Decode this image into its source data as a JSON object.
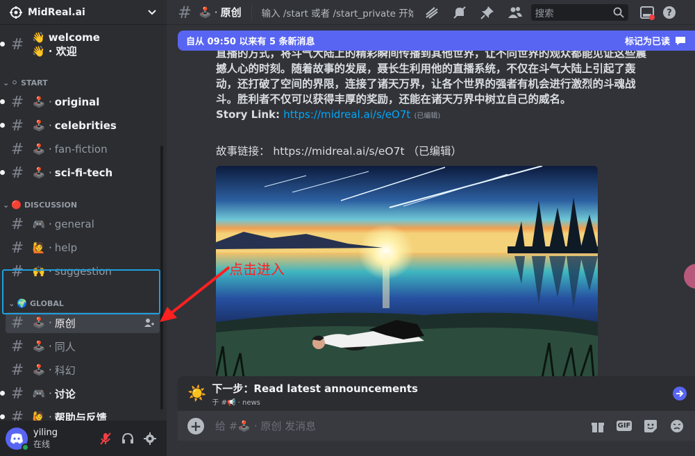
{
  "server": {
    "name": "MidReal.ai"
  },
  "channels": {
    "welcome": {
      "emoji": "👋",
      "name": "welcome",
      "emoji2": "👋",
      "sep": "·",
      "name2": "欢迎"
    },
    "start_category": {
      "emoji": "⚪",
      "label": "START"
    },
    "start_items": [
      {
        "emoji": "🕹️",
        "sep": "·",
        "name": "original"
      },
      {
        "emoji": "🕹️",
        "sep": "·",
        "name": "celebrities"
      },
      {
        "emoji": "🕹️",
        "sep": "·",
        "name": "fan-fiction"
      },
      {
        "emoji": "🕹️",
        "sep": "·",
        "name": "sci-fi-tech"
      }
    ],
    "discussion_category": {
      "emoji": "🔴",
      "label": "DISCUSSION"
    },
    "discussion_items": [
      {
        "emoji": "🎮",
        "sep": "·",
        "name": "general"
      },
      {
        "emoji": "🙋",
        "sep": "·",
        "name": "help"
      },
      {
        "emoji": "🙌",
        "sep": "·",
        "name": "suggestion"
      }
    ],
    "global_category": {
      "emoji": "🌍",
      "label": "GLOBAL"
    },
    "global_items": [
      {
        "emoji": "🕹️",
        "sep": "·",
        "name": "原创"
      },
      {
        "emoji": "🕹️",
        "sep": "·",
        "name": "同人"
      },
      {
        "emoji": "🕹️",
        "sep": "·",
        "name": "科幻"
      },
      {
        "emoji": "🎮",
        "sep": "·",
        "name": "讨论"
      },
      {
        "emoji": "🙋",
        "sep": "·",
        "name": "帮助与反馈"
      }
    ]
  },
  "user": {
    "name": "yiling",
    "status": "在线"
  },
  "header": {
    "hash": "#",
    "emoji": "🕹️",
    "sep": "·",
    "title": "原创",
    "topic": "输入 /start 或者 /start_private 开始",
    "search_placeholder": "搜索"
  },
  "banner": {
    "text": "自从 09:50 以来有 5 条新消息",
    "mark_read": "标记为已读"
  },
  "message": {
    "line0": "直播的方式，将斗气大陆上的精彩瞬间传播到其他世界，让不同世界的观众都能见证这些震",
    "line1": "撼人心的时刻。随着故事的发展，聂长生利用他的直播系统，不仅在斗气大陆上引起了轰",
    "line2": "动，还打破了空间的界限，连接了诸天万界，让各个世界的强者有机会进行激烈的斗魂战",
    "line3": "斗。胜利者不仅可以获得丰厚的奖励，还能在诸天万界中树立自己的威名。",
    "story_link_label": "Story Link:",
    "story_link_url": "https://midreal.ai/s/eO7t",
    "edited": "(已编辑)",
    "story_link2": "故事链接： https://midreal.ai/s/eO7t （已编辑）"
  },
  "annotation": {
    "text": "点击进入"
  },
  "next_step": {
    "prefix": "下一步：",
    "title": "Read latest announcements",
    "sub_prefix": "于 #",
    "sub_emoji": "📢",
    "sub_sep": "·",
    "sub_channel": "news"
  },
  "composer": {
    "placeholder": "给 #🕹️ · 原创 发消息",
    "gif_label": "GIF"
  }
}
